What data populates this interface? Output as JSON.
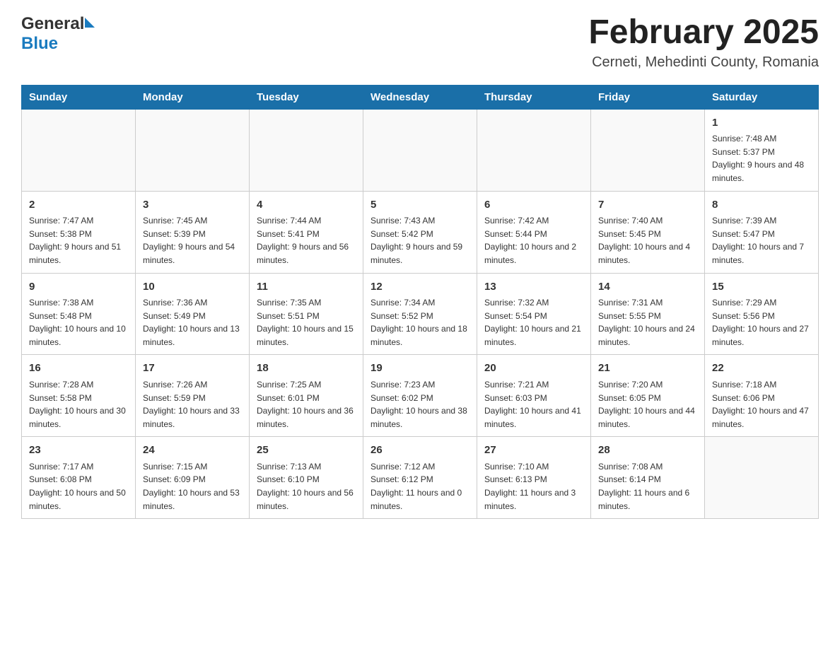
{
  "header": {
    "logo_general": "General",
    "logo_blue": "Blue",
    "month_title": "February 2025",
    "location": "Cerneti, Mehedinti County, Romania"
  },
  "days_of_week": [
    "Sunday",
    "Monday",
    "Tuesday",
    "Wednesday",
    "Thursday",
    "Friday",
    "Saturday"
  ],
  "weeks": [
    [
      {
        "day": "",
        "sunrise": "",
        "sunset": "",
        "daylight": ""
      },
      {
        "day": "",
        "sunrise": "",
        "sunset": "",
        "daylight": ""
      },
      {
        "day": "",
        "sunrise": "",
        "sunset": "",
        "daylight": ""
      },
      {
        "day": "",
        "sunrise": "",
        "sunset": "",
        "daylight": ""
      },
      {
        "day": "",
        "sunrise": "",
        "sunset": "",
        "daylight": ""
      },
      {
        "day": "",
        "sunrise": "",
        "sunset": "",
        "daylight": ""
      },
      {
        "day": "1",
        "sunrise": "Sunrise: 7:48 AM",
        "sunset": "Sunset: 5:37 PM",
        "daylight": "Daylight: 9 hours and 48 minutes."
      }
    ],
    [
      {
        "day": "2",
        "sunrise": "Sunrise: 7:47 AM",
        "sunset": "Sunset: 5:38 PM",
        "daylight": "Daylight: 9 hours and 51 minutes."
      },
      {
        "day": "3",
        "sunrise": "Sunrise: 7:45 AM",
        "sunset": "Sunset: 5:39 PM",
        "daylight": "Daylight: 9 hours and 54 minutes."
      },
      {
        "day": "4",
        "sunrise": "Sunrise: 7:44 AM",
        "sunset": "Sunset: 5:41 PM",
        "daylight": "Daylight: 9 hours and 56 minutes."
      },
      {
        "day": "5",
        "sunrise": "Sunrise: 7:43 AM",
        "sunset": "Sunset: 5:42 PM",
        "daylight": "Daylight: 9 hours and 59 minutes."
      },
      {
        "day": "6",
        "sunrise": "Sunrise: 7:42 AM",
        "sunset": "Sunset: 5:44 PM",
        "daylight": "Daylight: 10 hours and 2 minutes."
      },
      {
        "day": "7",
        "sunrise": "Sunrise: 7:40 AM",
        "sunset": "Sunset: 5:45 PM",
        "daylight": "Daylight: 10 hours and 4 minutes."
      },
      {
        "day": "8",
        "sunrise": "Sunrise: 7:39 AM",
        "sunset": "Sunset: 5:47 PM",
        "daylight": "Daylight: 10 hours and 7 minutes."
      }
    ],
    [
      {
        "day": "9",
        "sunrise": "Sunrise: 7:38 AM",
        "sunset": "Sunset: 5:48 PM",
        "daylight": "Daylight: 10 hours and 10 minutes."
      },
      {
        "day": "10",
        "sunrise": "Sunrise: 7:36 AM",
        "sunset": "Sunset: 5:49 PM",
        "daylight": "Daylight: 10 hours and 13 minutes."
      },
      {
        "day": "11",
        "sunrise": "Sunrise: 7:35 AM",
        "sunset": "Sunset: 5:51 PM",
        "daylight": "Daylight: 10 hours and 15 minutes."
      },
      {
        "day": "12",
        "sunrise": "Sunrise: 7:34 AM",
        "sunset": "Sunset: 5:52 PM",
        "daylight": "Daylight: 10 hours and 18 minutes."
      },
      {
        "day": "13",
        "sunrise": "Sunrise: 7:32 AM",
        "sunset": "Sunset: 5:54 PM",
        "daylight": "Daylight: 10 hours and 21 minutes."
      },
      {
        "day": "14",
        "sunrise": "Sunrise: 7:31 AM",
        "sunset": "Sunset: 5:55 PM",
        "daylight": "Daylight: 10 hours and 24 minutes."
      },
      {
        "day": "15",
        "sunrise": "Sunrise: 7:29 AM",
        "sunset": "Sunset: 5:56 PM",
        "daylight": "Daylight: 10 hours and 27 minutes."
      }
    ],
    [
      {
        "day": "16",
        "sunrise": "Sunrise: 7:28 AM",
        "sunset": "Sunset: 5:58 PM",
        "daylight": "Daylight: 10 hours and 30 minutes."
      },
      {
        "day": "17",
        "sunrise": "Sunrise: 7:26 AM",
        "sunset": "Sunset: 5:59 PM",
        "daylight": "Daylight: 10 hours and 33 minutes."
      },
      {
        "day": "18",
        "sunrise": "Sunrise: 7:25 AM",
        "sunset": "Sunset: 6:01 PM",
        "daylight": "Daylight: 10 hours and 36 minutes."
      },
      {
        "day": "19",
        "sunrise": "Sunrise: 7:23 AM",
        "sunset": "Sunset: 6:02 PM",
        "daylight": "Daylight: 10 hours and 38 minutes."
      },
      {
        "day": "20",
        "sunrise": "Sunrise: 7:21 AM",
        "sunset": "Sunset: 6:03 PM",
        "daylight": "Daylight: 10 hours and 41 minutes."
      },
      {
        "day": "21",
        "sunrise": "Sunrise: 7:20 AM",
        "sunset": "Sunset: 6:05 PM",
        "daylight": "Daylight: 10 hours and 44 minutes."
      },
      {
        "day": "22",
        "sunrise": "Sunrise: 7:18 AM",
        "sunset": "Sunset: 6:06 PM",
        "daylight": "Daylight: 10 hours and 47 minutes."
      }
    ],
    [
      {
        "day": "23",
        "sunrise": "Sunrise: 7:17 AM",
        "sunset": "Sunset: 6:08 PM",
        "daylight": "Daylight: 10 hours and 50 minutes."
      },
      {
        "day": "24",
        "sunrise": "Sunrise: 7:15 AM",
        "sunset": "Sunset: 6:09 PM",
        "daylight": "Daylight: 10 hours and 53 minutes."
      },
      {
        "day": "25",
        "sunrise": "Sunrise: 7:13 AM",
        "sunset": "Sunset: 6:10 PM",
        "daylight": "Daylight: 10 hours and 56 minutes."
      },
      {
        "day": "26",
        "sunrise": "Sunrise: 7:12 AM",
        "sunset": "Sunset: 6:12 PM",
        "daylight": "Daylight: 11 hours and 0 minutes."
      },
      {
        "day": "27",
        "sunrise": "Sunrise: 7:10 AM",
        "sunset": "Sunset: 6:13 PM",
        "daylight": "Daylight: 11 hours and 3 minutes."
      },
      {
        "day": "28",
        "sunrise": "Sunrise: 7:08 AM",
        "sunset": "Sunset: 6:14 PM",
        "daylight": "Daylight: 11 hours and 6 minutes."
      },
      {
        "day": "",
        "sunrise": "",
        "sunset": "",
        "daylight": ""
      }
    ]
  ]
}
